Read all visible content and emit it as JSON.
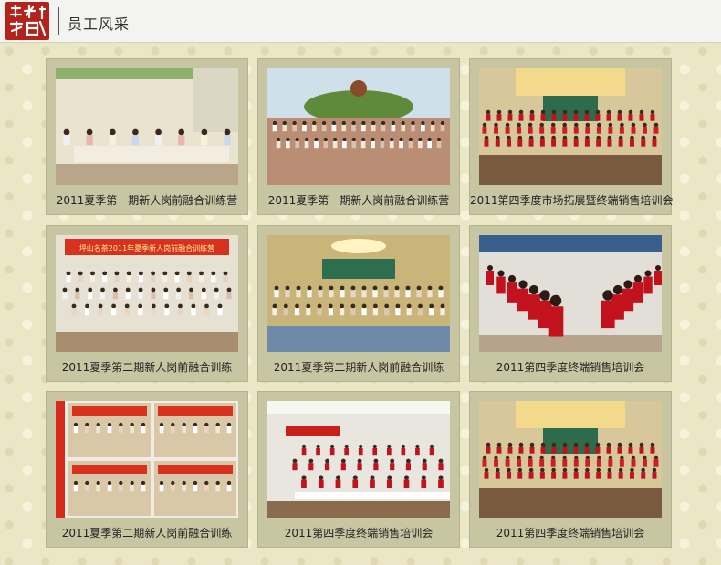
{
  "header": {
    "logo_text": "名茶坪山",
    "title": "员工风采"
  },
  "gallery": [
    {
      "caption": "2011夏季第一期新人岗前融合训练营",
      "scene": "indoor-group"
    },
    {
      "caption": "2011夏季第一期新人岗前融合训练营",
      "scene": "outdoor-group"
    },
    {
      "caption": "2011第四季度市场拓展暨终端销售培训会",
      "scene": "red-uniform-stage"
    },
    {
      "caption": "2011夏季第二期新人岗前融合训练",
      "scene": "banner-group",
      "banner": "坪山名茶2011年夏季新人岗前融合训练营"
    },
    {
      "caption": "2011夏季第二期新人岗前融合训练",
      "scene": "hall-group"
    },
    {
      "caption": "2011第四季度终端销售培训会",
      "scene": "red-uniform-line"
    },
    {
      "caption": "2011夏季第二期新人岗前融合训练",
      "scene": "collage"
    },
    {
      "caption": "2011第四季度终端销售培训会",
      "scene": "classroom"
    },
    {
      "caption": "2011第四季度终端销售培训会",
      "scene": "red-uniform-stage"
    }
  ],
  "colors": {
    "accent_red": "#b3231c",
    "card_bg": "#c8c6a2",
    "page_bg": "#ebe6c6"
  }
}
